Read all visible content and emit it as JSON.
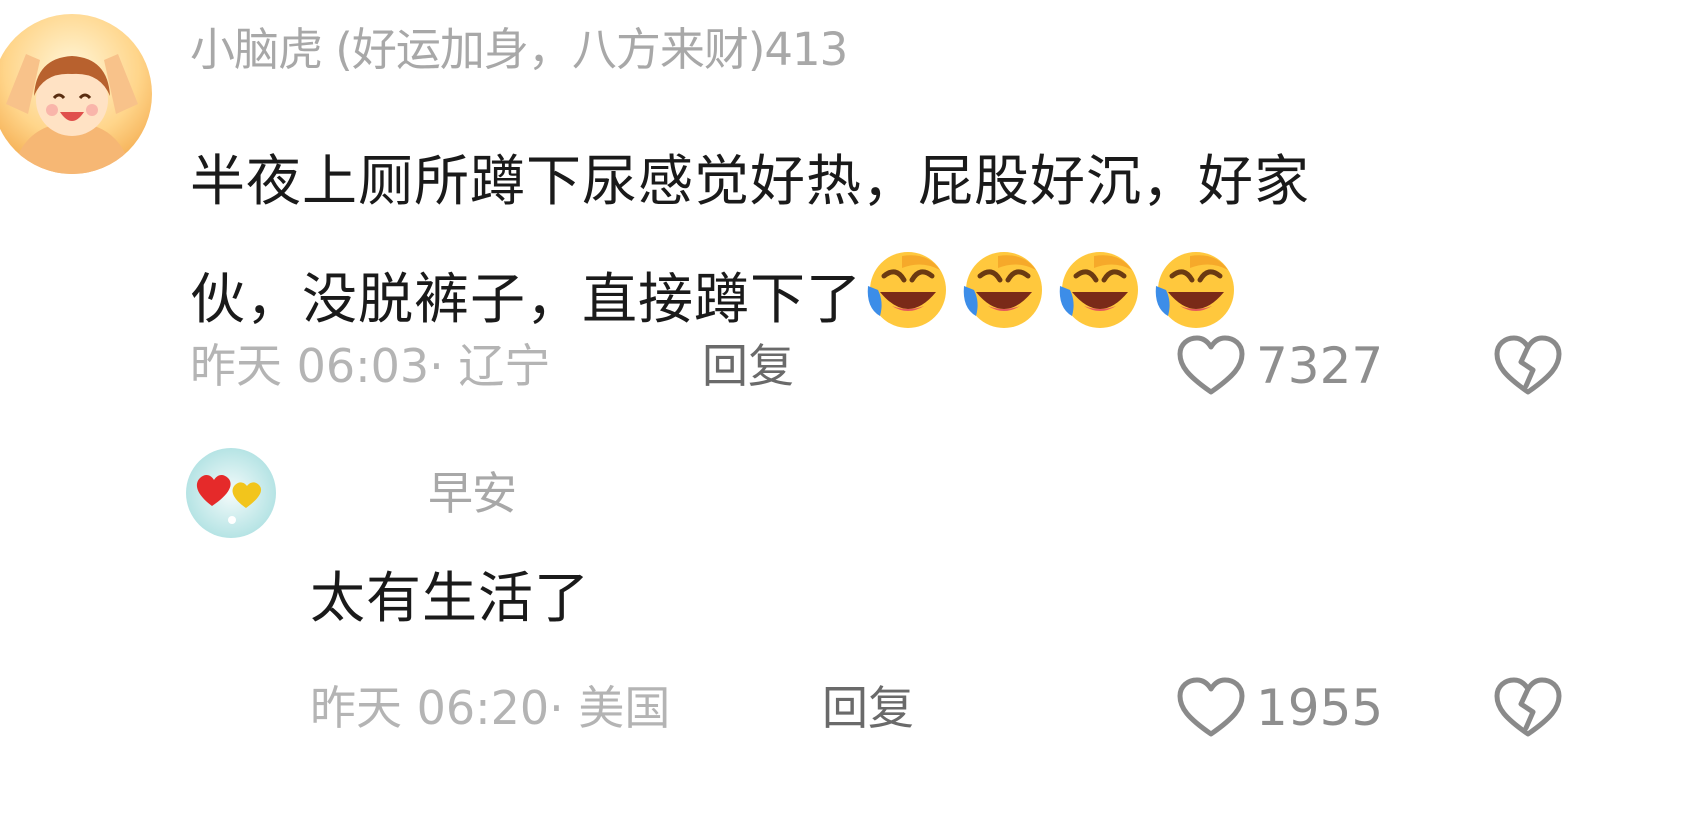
{
  "comments": [
    {
      "username": "小脑虎 (好运加身，八方来财)413",
      "content_line1": "半夜上厕所蹲下尿感觉好热，屁股好沉，好家",
      "content_line2": "伙，没脱裤子，直接蹲下了",
      "emojis": [
        "laugh-cry-emoji",
        "laugh-cry-emoji",
        "laugh-cry-emoji",
        "laugh-cry-emoji"
      ],
      "meta": "昨天 06:03· 辽宁",
      "reply_label": "回复",
      "like_count": "7327"
    },
    {
      "username": "早安",
      "content": "太有生活了",
      "meta": "昨天 06:20· 美国",
      "reply_label": "回复",
      "like_count": "1955"
    }
  ],
  "colors": {
    "username": "#a8a8a8",
    "content": "#1a1a1a",
    "meta": "#b4b4b4",
    "reply": "#6a6a6a",
    "like_count": "#8e8e8e",
    "icon_stroke": "#8a8a8a"
  }
}
